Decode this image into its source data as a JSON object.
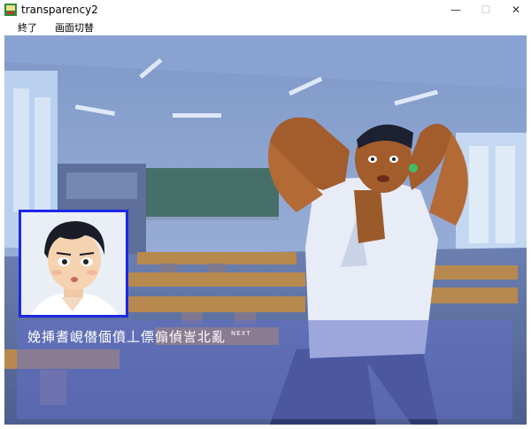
{
  "window": {
    "title": "transparency2",
    "icon": "game-icon",
    "controls": {
      "minimize": "—",
      "maximize": "☐",
      "close": "✕"
    }
  },
  "menu": {
    "items": [
      "終了",
      "画面切替"
    ]
  },
  "game": {
    "dialog_text": "娩挿耆峴僣偭僨丄僄傓偵訔北亂",
    "next_label": "NEXT",
    "portrait_border_color": "#1d27e6",
    "textbox_color": "#6270c8"
  }
}
